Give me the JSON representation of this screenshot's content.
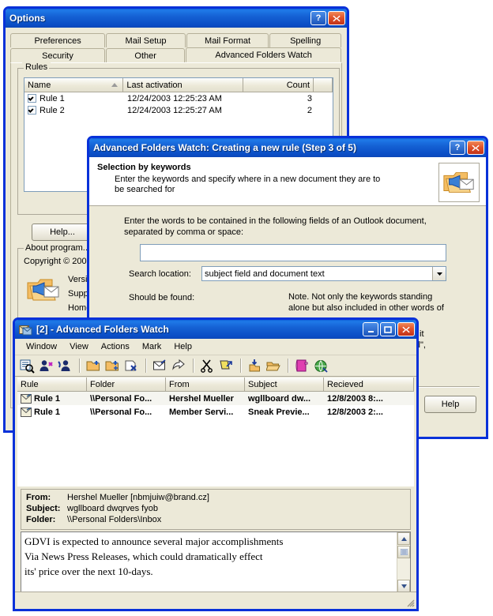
{
  "options_dialog": {
    "title": "Options",
    "titlebar_buttons": [
      {
        "name": "help-button",
        "glyph": "?"
      },
      {
        "name": "close-button",
        "glyph": "✕"
      }
    ],
    "tabs_row1": [
      "Preferences",
      "Mail Setup",
      "Mail Format",
      "Spelling"
    ],
    "tabs_row2": [
      "Security",
      "Other",
      "Advanced Folders Watch"
    ],
    "selected_tab": "Advanced Folders Watch",
    "rules_group": {
      "title": "Rules",
      "columns": [
        "Name",
        "Last activation",
        "Count"
      ],
      "sorted_column": "Name",
      "rows": [
        {
          "checked": true,
          "name": "Rule 1",
          "last_activation": "12/24/2003 12:25:23 AM",
          "count": "3"
        },
        {
          "checked": true,
          "name": "Rule 2",
          "last_activation": "12/24/2003 12:25:27 AM",
          "count": "2"
        }
      ]
    },
    "help_button": "Help...",
    "about_group": {
      "title": "About program...",
      "copyright": "Copyright © 200",
      "lines": [
        "Versio",
        "Supp",
        "Home"
      ]
    }
  },
  "wizard_dialog": {
    "title": "Advanced Folders Watch: Creating a new rule (Step 3 of 5)",
    "titlebar_buttons": [
      {
        "name": "help-button",
        "glyph": "?"
      },
      {
        "name": "close-button",
        "glyph": "✕"
      }
    ],
    "header_title": "Selection by keywords",
    "header_subtitle": "Enter the keywords and specify where in a new document they are to be searched for",
    "header_icon": "folder-mail-icon",
    "instruction_line1": "Enter the words to be contained in the following fields of an Outlook document,",
    "instruction_line2": "separated by comma or space:",
    "keywords_input_value": "",
    "search_location_label": "Search location:",
    "search_location_value": "subject field and document text",
    "should_be_found_label": "Should be found:",
    "note_line1": "Note. Not only the keywords standing",
    "note_line2": "alone but also included in other words of",
    "note_fragment1": "\", it",
    "note_fragment2": "ail\",",
    "help_button": "Help"
  },
  "afw_window": {
    "title": "[2] - Advanced Folders Watch",
    "app_icon": "folders-watch-icon",
    "titlebar_buttons": [
      {
        "name": "minimize-button",
        "glyph": "–"
      },
      {
        "name": "maximize-button",
        "glyph": "□"
      },
      {
        "name": "close-button",
        "glyph": "✕"
      }
    ],
    "menu": [
      "Window",
      "View",
      "Actions",
      "Mark",
      "Help"
    ],
    "toolbar_icons": [
      "find-message-icon",
      "add-sender-icon",
      "block-sender-icon",
      "new-folder-icon",
      "add-folder-icon",
      "delete-folder-icon",
      "mark-read-icon",
      "reply-icon",
      "cut-icon",
      "move-icon",
      "export-icon",
      "open-folder-icon",
      "address-book-icon",
      "web-icon"
    ],
    "list": {
      "columns": [
        "Rule",
        "Folder",
        "From",
        "Subject",
        "Recieved"
      ],
      "rows": [
        {
          "icon": "mail-rule-icon",
          "rule": "Rule 1",
          "folder": "\\\\Personal Fo...",
          "from": "Hershel Mueller",
          "subject": "wgllboard dw...",
          "recieved": "12/8/2003 8:..."
        },
        {
          "icon": "mail-rule-icon",
          "rule": "Rule 1",
          "folder": "\\\\Personal Fo...",
          "from": "Member Servi...",
          "subject": "Sneak Previe...",
          "recieved": "12/8/2003 2:..."
        }
      ]
    },
    "preview": {
      "from_label": "From:",
      "from_value": "Hershel Mueller [nbmjuiw@brand.cz]",
      "subject_label": "Subject:",
      "subject_value": "wgllboard dwqrves fyob",
      "folder_label": "Folder:",
      "folder_value": "\\\\Personal Folders\\Inbox"
    },
    "body_lines": [
      "GDVI is expected to announce several major accomplishments",
      "Via News Press Releases, which could dramatically effect",
      "its' price over the next 10-days."
    ]
  },
  "colors": {
    "titlebar_blue": "#0a4cc4",
    "window_border": "#0831d9",
    "face": "#ece9d8",
    "field_border": "#7f9db9",
    "close_red": "#c0321a"
  }
}
